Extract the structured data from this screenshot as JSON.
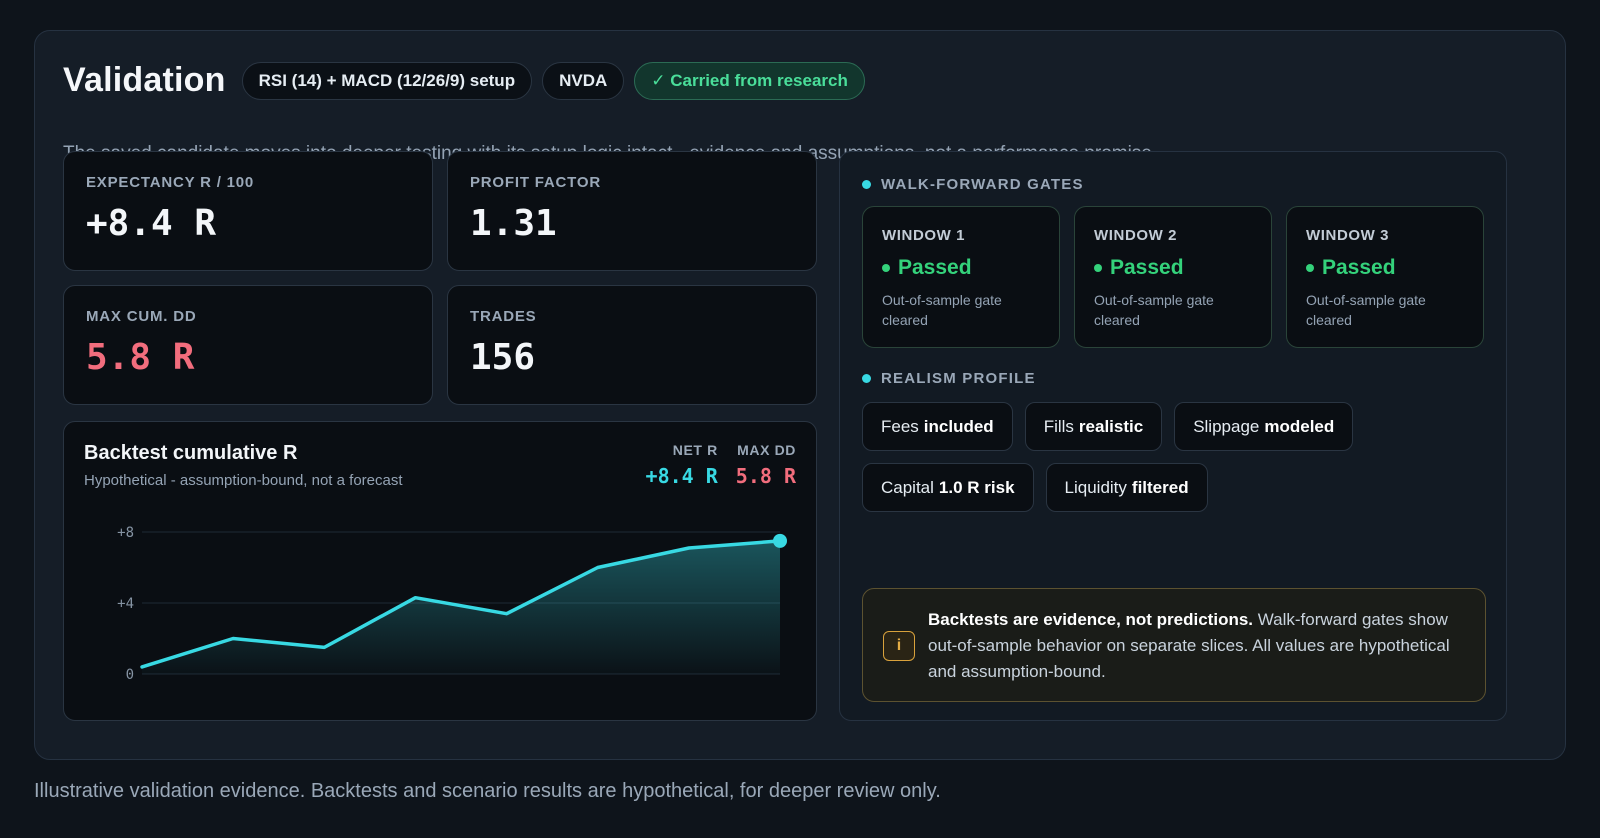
{
  "header": {
    "title": "Validation",
    "chips": {
      "setup": "RSI (14) + MACD (12/26/9) setup",
      "ticker": "NVDA",
      "status": "✓ Carried from research"
    },
    "subtitle": "The saved candidate moves into deeper testing with its setup logic intact - evidence and assumptions, not a performance promise."
  },
  "stats": {
    "expectancy": {
      "label": "EXPECTANCY R / 100",
      "value": "+8.4 R"
    },
    "profit_factor": {
      "label": "PROFIT FACTOR",
      "value": "1.31"
    },
    "max_dd": {
      "label": "MAX CUM. DD",
      "value": "5.8 R"
    },
    "trades": {
      "label": "TRADES",
      "value": "156"
    }
  },
  "chart": {
    "title": "Backtest cumulative R",
    "subtitle": "Hypothetical - assumption-bound, not a forecast",
    "net_label": "NET R",
    "net_value": "+8.4 R",
    "dd_label": "MAX DD",
    "dd_value": "5.8 R"
  },
  "chart_data": {
    "type": "area",
    "title": "Backtest cumulative R",
    "x": [
      0,
      1,
      2,
      3,
      4,
      5,
      6,
      7
    ],
    "values": [
      0.4,
      2.0,
      1.5,
      4.3,
      3.4,
      6.0,
      7.1,
      7.5
    ],
    "yticks": [
      {
        "v": 0,
        "label": "0"
      },
      {
        "v": 4,
        "label": "+4"
      },
      {
        "v": 8,
        "label": "+8"
      }
    ],
    "ylim": [
      0,
      8
    ],
    "grid": true,
    "colors": {
      "line": "#38d9e3"
    }
  },
  "walk_forward": {
    "title": "WALK-FORWARD GATES",
    "windows": [
      {
        "label": "WINDOW 1",
        "status": "Passed",
        "desc": "Out-of-sample gate cleared"
      },
      {
        "label": "WINDOW 2",
        "status": "Passed",
        "desc": "Out-of-sample gate cleared"
      },
      {
        "label": "WINDOW 3",
        "status": "Passed",
        "desc": "Out-of-sample gate cleared"
      }
    ]
  },
  "realism": {
    "title": "REALISM PROFILE",
    "tags": [
      {
        "a": "Fees",
        "b": "included"
      },
      {
        "a": "Fills",
        "b": "realistic"
      },
      {
        "a": "Slippage",
        "b": "modeled"
      },
      {
        "a": "Capital",
        "b": "1.0 R risk"
      },
      {
        "a": "Liquidity",
        "b": "filtered"
      }
    ]
  },
  "note": {
    "icon": "i",
    "bold": "Backtests are evidence, not predictions.",
    "text": " Walk-forward gates show out-of-sample behavior on separate slices. All values are hypothetical and assumption-bound."
  },
  "footer": "Illustrative validation evidence. Backtests and scenario results are hypothetical, for deeper review only."
}
